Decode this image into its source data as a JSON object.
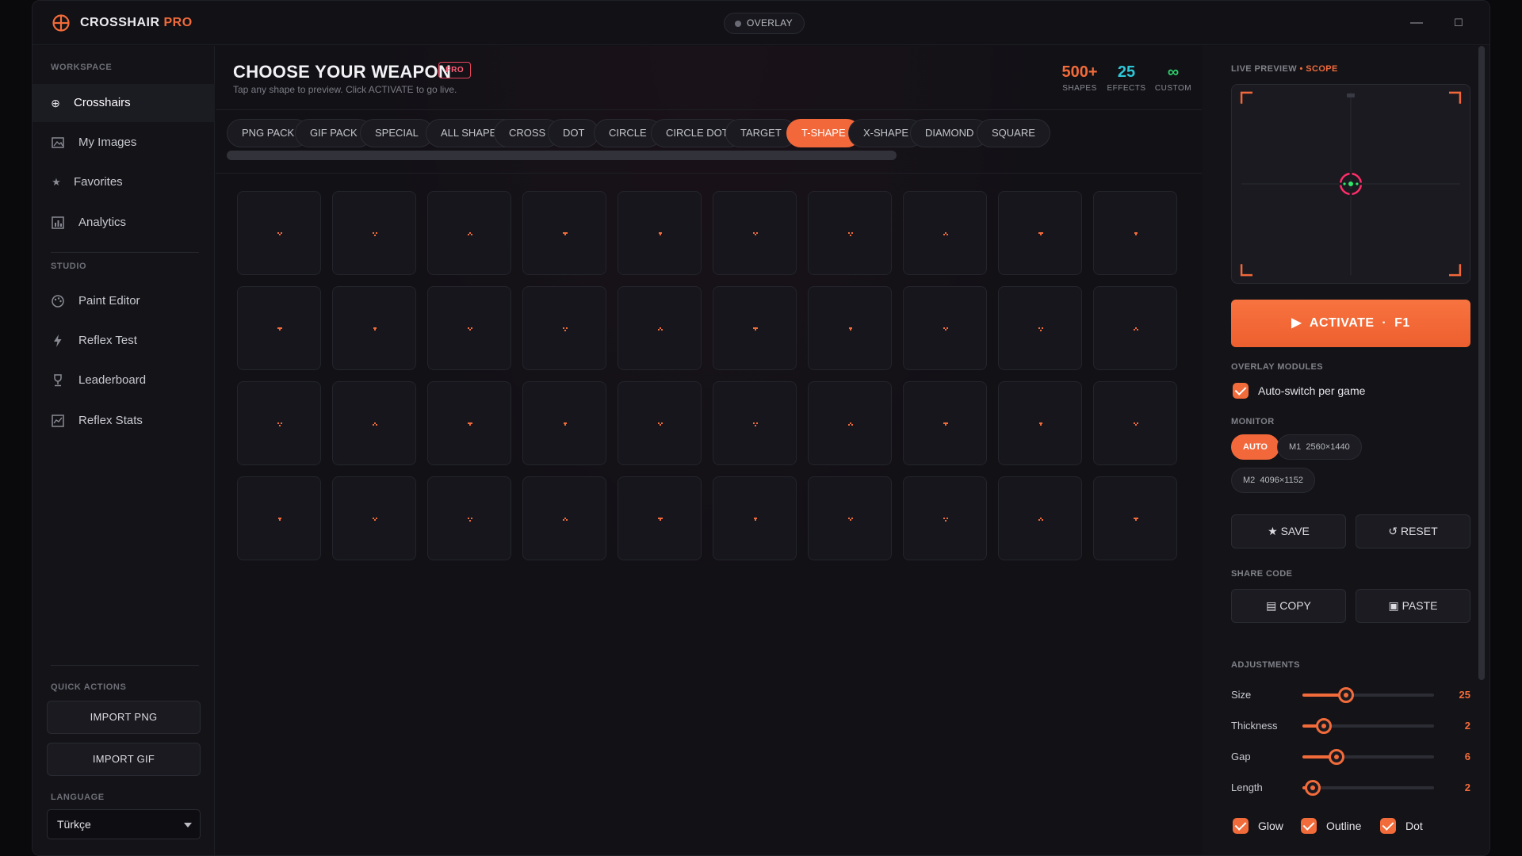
{
  "titlebar": {
    "app_name": "CROSSHAIR",
    "app_name_accent": "PRO",
    "overlay_label": "OVERLAY",
    "minimize": "—",
    "maximize": "☐",
    "close": "✕"
  },
  "sidebar": {
    "workspace_label": "WORKSPACE",
    "workspace_items": [
      {
        "label": "Crosshairs",
        "icon": "crosshair-icon",
        "active": true
      },
      {
        "label": "My Images",
        "icon": "image-icon"
      },
      {
        "label": "Favorites",
        "icon": "star-icon"
      },
      {
        "label": "Analytics",
        "icon": "chart-icon"
      }
    ],
    "studio_label": "STUDIO",
    "studio_items": [
      {
        "label": "Paint Editor",
        "icon": "palette-icon"
      },
      {
        "label": "Reflex Test",
        "icon": "bolt-icon"
      },
      {
        "label": "Leaderboard",
        "icon": "trophy-icon"
      },
      {
        "label": "Reflex Stats",
        "icon": "stats-icon"
      }
    ],
    "quick_actions_label": "QUICK ACTIONS",
    "import_png": "IMPORT PNG",
    "import_gif": "IMPORT GIF",
    "language_label": "LANGUAGE",
    "language_value": "Türkçe"
  },
  "main": {
    "title": "CHOOSE YOUR WEAPON",
    "pro_badge": "PRO",
    "subtitle": "Tap any shape to preview. Click ACTIVATE to go live.",
    "stats": [
      {
        "value": "500+",
        "label": "SHAPES",
        "color": "#f26b3a"
      },
      {
        "value": "25",
        "label": "EFFECTS",
        "color": "#2ec6d6"
      },
      {
        "value": "∞",
        "label": "CUSTOM",
        "color": "#2fd06a"
      }
    ],
    "tabs": [
      "PNG PACK",
      "GIF PACK",
      "SPECIAL",
      "ALL SHAPES",
      "CROSS",
      "DOT",
      "CIRCLE",
      "CIRCLE DOT",
      "TARGET",
      "T-SHAPE",
      "X-SHAPE",
      "DIAMOND",
      "SQUARE"
    ],
    "active_tab": "T-SHAPE",
    "grid": {
      "rows": 4,
      "cols": 10,
      "accent": "#f06a3a"
    }
  },
  "right": {
    "preview_label": "LIVE PREVIEW",
    "preview_mode": "SCOPE",
    "activate_label": "ACTIVATE",
    "activate_key": "F1",
    "overlay_modules_label": "OVERLAY MODULES",
    "auto_switch_label": "Auto-switch per game",
    "monitor_label": "MONITOR",
    "monitors": [
      {
        "name": "AUTO",
        "res": "",
        "active": true
      },
      {
        "name": "M1",
        "res": "2560×1440"
      },
      {
        "name": "M2",
        "res": "4096×1152"
      }
    ],
    "save_label": "SAVE",
    "reset_label": "RESET",
    "share_code_label": "SHARE CODE",
    "copy_label": "COPY",
    "paste_label": "PASTE",
    "adjustments_label": "ADJUSTMENTS",
    "adjustments": [
      {
        "label": "Size",
        "value": "25",
        "fraction": 0.33
      },
      {
        "label": "Thickness",
        "value": "2",
        "fraction": 0.16
      },
      {
        "label": "Gap",
        "value": "6",
        "fraction": 0.26
      },
      {
        "label": "Length",
        "value": "2",
        "fraction": 0.08
      }
    ],
    "toggles": [
      {
        "label": "Glow",
        "checked": true
      },
      {
        "label": "Outline",
        "checked": true
      },
      {
        "label": "Dot",
        "checked": true
      }
    ]
  }
}
